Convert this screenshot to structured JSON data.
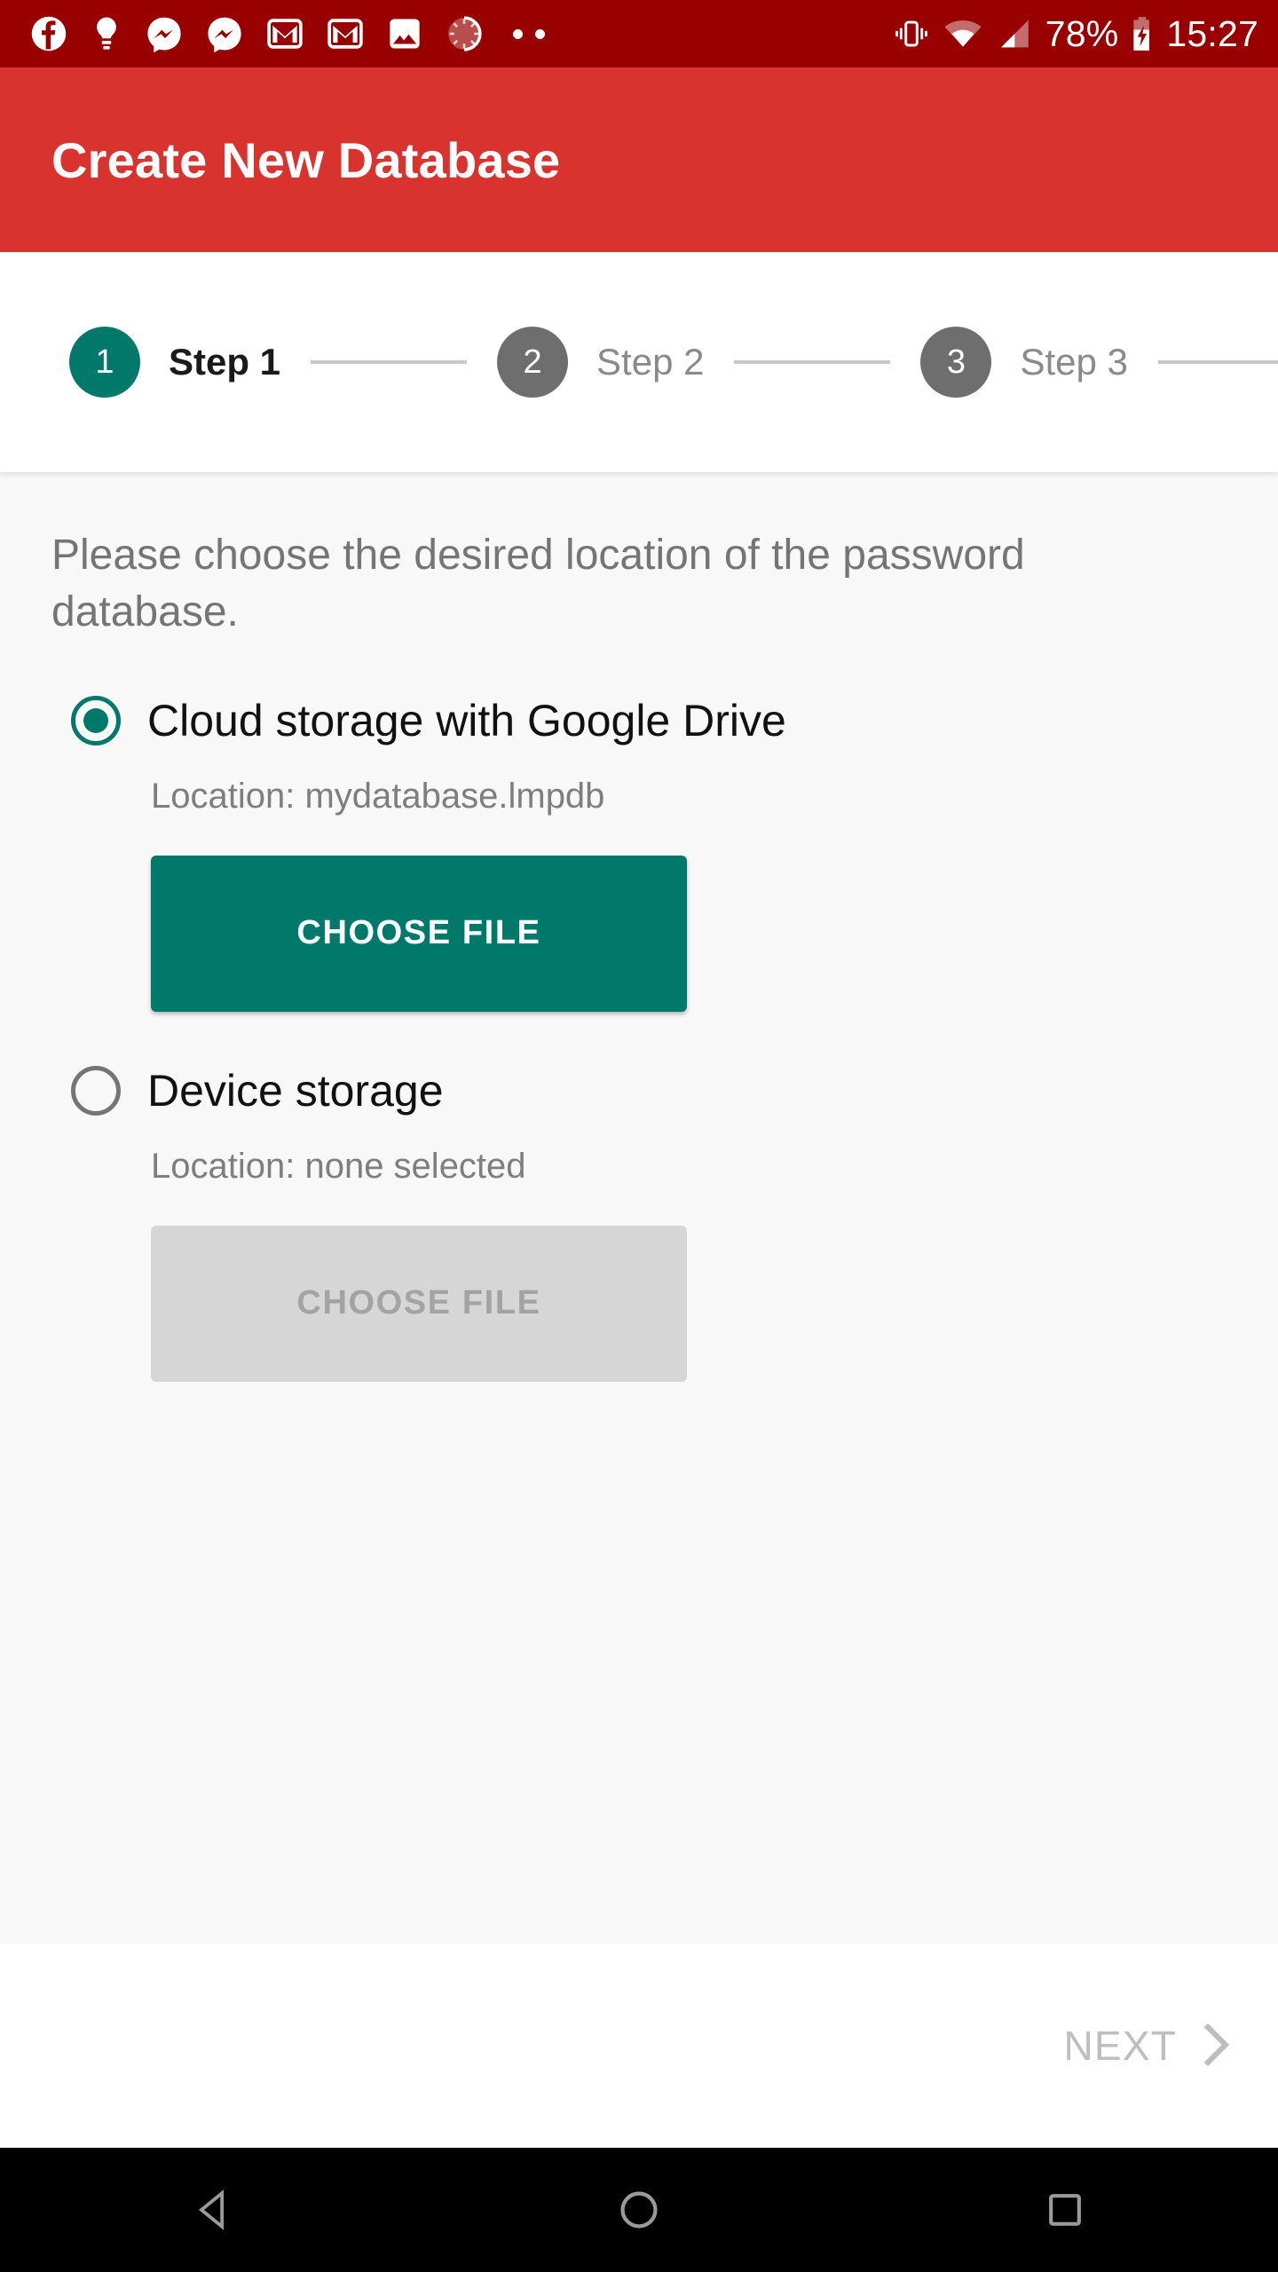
{
  "status_bar": {
    "background_color": "#990000",
    "notification_icons": [
      "facebook-icon",
      "lightbulb-icon",
      "messenger-icon",
      "messenger-icon",
      "gmail-icon",
      "gmail-icon",
      "photo-icon",
      "sync-spinner-icon",
      "more-notifications-icon"
    ],
    "vibrate_icon": "vibrate-icon",
    "wifi_icon": "wifi-icon",
    "cellular_icon": "cellular-signal-icon",
    "battery_percent": "78%",
    "battery_icon": "battery-charging-icon",
    "clock": "15:27"
  },
  "app_bar": {
    "title": "Create New Database",
    "background_color": "#D8332F"
  },
  "stepper": {
    "steps": [
      {
        "number": "1",
        "label": "Step 1",
        "state": "active"
      },
      {
        "number": "2",
        "label": "Step 2",
        "state": "inactive"
      },
      {
        "number": "3",
        "label": "Step 3",
        "state": "inactive"
      }
    ],
    "active_color": "#00796B",
    "inactive_color": "#6E6E6E"
  },
  "content": {
    "instruction": "Please choose the desired location of the password database.",
    "options": [
      {
        "label": "Cloud storage with Google Drive",
        "selected": true,
        "location": "Location: mydatabase.lmpdb",
        "button_label": "CHOOSE FILE",
        "button_enabled": true
      },
      {
        "label": "Device storage",
        "selected": false,
        "location": "Location: none selected",
        "button_label": "CHOOSE FILE",
        "button_enabled": false
      }
    ]
  },
  "bottom_bar": {
    "next_label": "NEXT",
    "next_icon": "chevron-right-icon",
    "enabled": false
  },
  "nav_bar": {
    "back_icon": "back-triangle-icon",
    "home_icon": "home-circle-icon",
    "recents_icon": "recents-square-icon"
  }
}
